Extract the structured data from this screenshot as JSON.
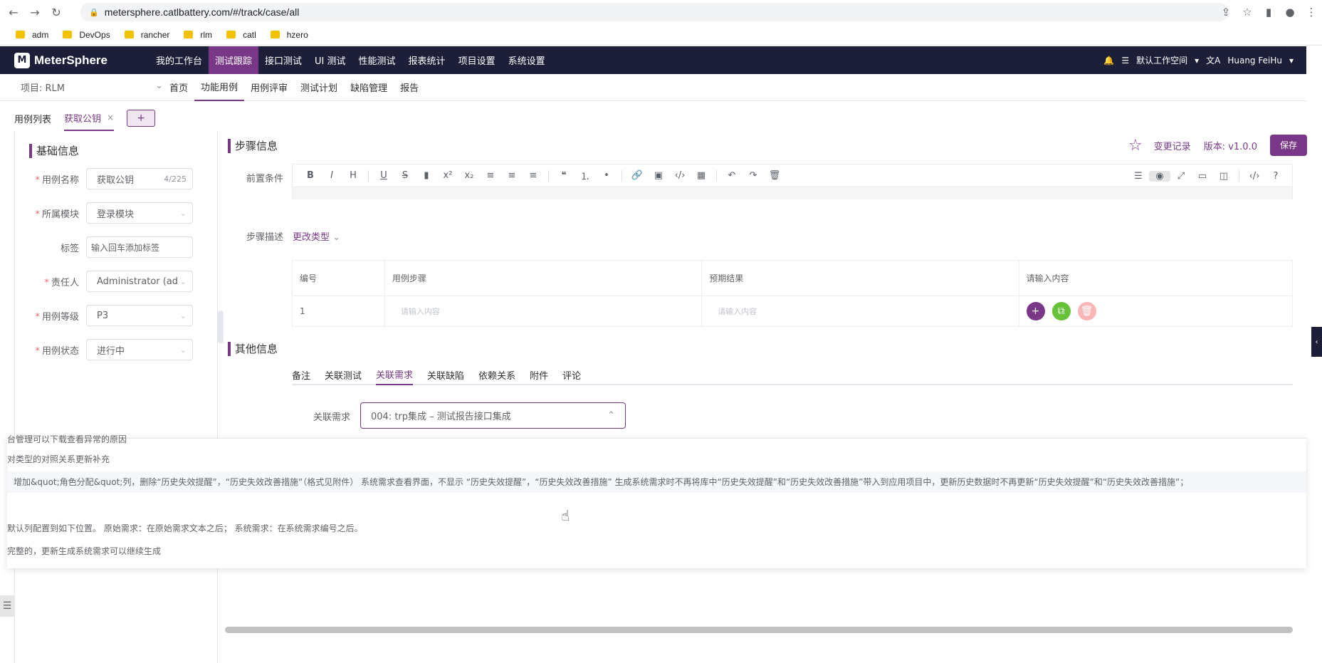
{
  "browser": {
    "url": "metersphere.catlbattery.com/#/track/case/all",
    "bookmarks": [
      "adm",
      "DevOps",
      "rancher",
      "rlm",
      "catl",
      "hzero"
    ]
  },
  "header": {
    "logo": "MeterSphere",
    "menu": [
      "我的工作台",
      "测试跟踪",
      "接口测试",
      "UI 测试",
      "性能测试",
      "报表统计",
      "项目设置",
      "系统设置"
    ],
    "active_menu": 1,
    "workspace": "默认工作空间",
    "user": "Huang FeiHu"
  },
  "subnav": {
    "project": "项目: RLM",
    "items": [
      "首页",
      "功能用例",
      "用例评审",
      "测试计划",
      "缺陷管理",
      "报告"
    ]
  },
  "tabs": {
    "list_label": "用例列表",
    "active_tab": "获取公钥",
    "close": "×",
    "add": "+"
  },
  "basic_info": {
    "title": "基础信息",
    "fields": [
      {
        "label": "用例名称",
        "required": true,
        "value": "获取公钥",
        "count": "4/225"
      },
      {
        "label": "所属模块",
        "required": true,
        "value": "登录模块"
      },
      {
        "label": "标签",
        "required": false,
        "placeholder": "输入回车添加标签"
      },
      {
        "label": "责任人",
        "required": true,
        "value": "Administrator (admi"
      },
      {
        "label": "用例等级",
        "required": true,
        "value": "P3"
      },
      {
        "label": "用例状态",
        "required": true,
        "value": "进行中"
      }
    ]
  },
  "steps": {
    "title": "步骤信息",
    "change_log": "变更记录",
    "version": "版本: v1.0.0",
    "save": "保存",
    "precondition_label": "前置条件",
    "step_desc_label": "步骤描述",
    "change_type": "更改类型",
    "table_headers": [
      "编号",
      "用例步骤",
      "预期结果",
      "请输入内容"
    ],
    "row": {
      "num": "1",
      "step_placeholder": "请输入内容",
      "result_placeholder": "请输入内容"
    }
  },
  "other": {
    "title": "其他信息",
    "tabs": [
      "备注",
      "关联测试",
      "关联需求",
      "关联缺陷",
      "依赖关系",
      "附件",
      "评论"
    ],
    "active_tab": 2,
    "req_label": "关联需求",
    "req_value": "004: trp集成 – 测试报告接口集成"
  },
  "dropdown_options": [
    "台管理可以下载查看异常的原因",
    "对类型的对照关系更新补充",
    "增加&quot;角色分配&quot;列，删除“历史失效提醒”，“历史失效改善措施”（格式见附件） 系统需求查看界面，不显示 “历史失效提醒”，“历史失效改善措施” 生成系统需求时不再将库中“历史失效提醒”和“历史失效改善措施”带入到应用项目中，更新历史数据时不再更新“历史失效提醒”和“历史失效改善措施”；",
    "",
    "默认列配置到如下位置。 原始需求：在原始需求文本之后； 系统需求：在系统需求编号之后。",
    "完整的，更新生成系统需求可以继续生成"
  ],
  "colors": {
    "accent": "#783887",
    "header_bg": "#1d1e38"
  }
}
